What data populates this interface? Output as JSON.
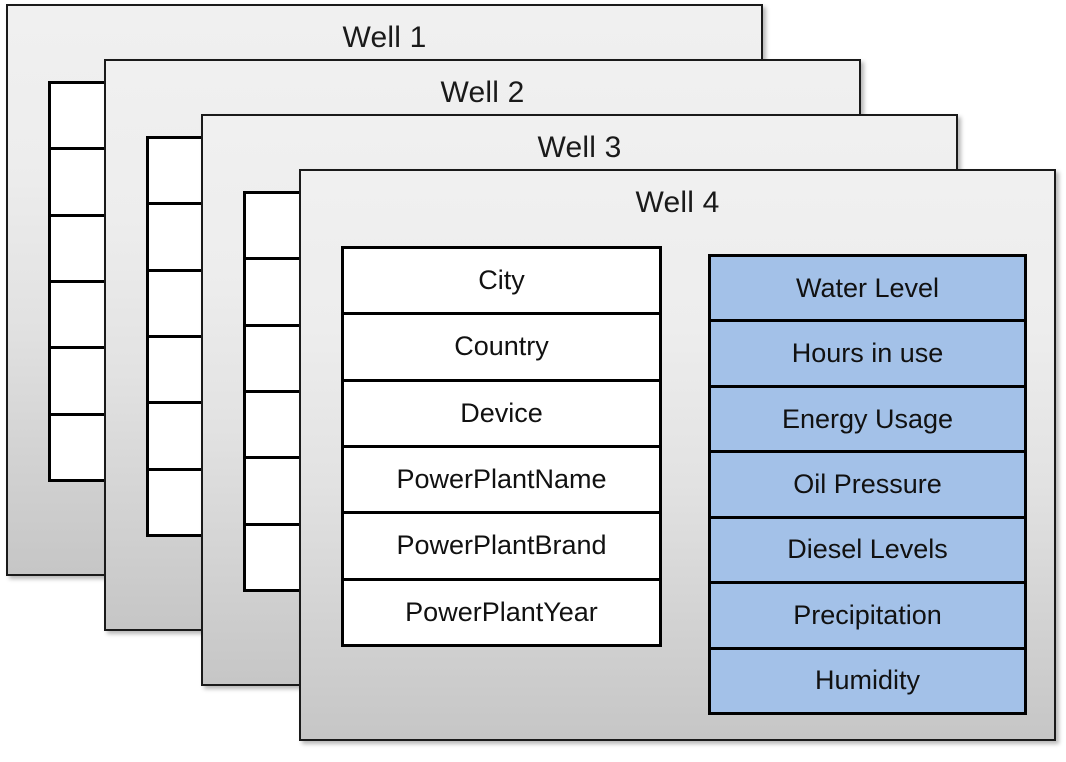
{
  "diagram": {
    "title_prefix": "Well",
    "attribute_fields": [
      "City",
      "Country",
      "Device",
      "PowerPlantName",
      "PowerPlantBrand",
      "PowerPlantYear"
    ],
    "sensor_fields": [
      "Water Level",
      "Hours in use",
      "Energy Usage",
      "Oil Pressure",
      "Diesel Levels",
      "Precipitation",
      "Humidity"
    ],
    "colors": {
      "sensor_fill": "#a3c1e8",
      "attribute_fill": "#ffffff",
      "card_top": "#f0f0f0",
      "card_bottom": "#c6c6c6",
      "border": "#000000"
    },
    "cards": [
      {
        "title": "Well 1"
      },
      {
        "title": "Well 2"
      },
      {
        "title": "Well 3"
      },
      {
        "title": "Well 4"
      }
    ]
  }
}
